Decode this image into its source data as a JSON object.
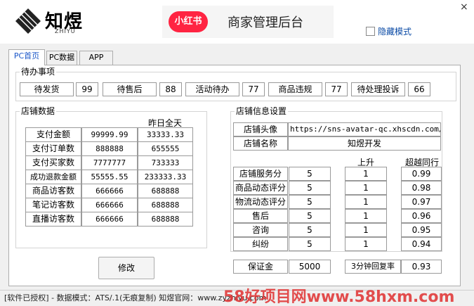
{
  "header": {
    "logo_text": "知煜",
    "logo_sub": "ZHIYU",
    "brand_badge": "小红书",
    "brand_title": "商家管理后台",
    "close_label": "×",
    "hide_mode_label": "隐藏模式"
  },
  "tabs": [
    {
      "label": "PC首页",
      "active": true
    },
    {
      "label": "PC数据",
      "active": false
    },
    {
      "label": "APP",
      "active": false
    }
  ],
  "todo": {
    "title": "待办事项",
    "items": [
      {
        "label": "待发货",
        "value": "99"
      },
      {
        "label": "待售后",
        "value": "88"
      },
      {
        "label": "活动待办",
        "value": "77"
      },
      {
        "label": "商品违规",
        "value": "77"
      },
      {
        "label": "待处理投诉",
        "value": "66"
      }
    ]
  },
  "shop_data": {
    "title": "店铺数据",
    "col_header": "昨日全天",
    "rows": [
      {
        "label": "支付金额",
        "today": "99999.99",
        "yesterday": "33333.33"
      },
      {
        "label": "支付订单数",
        "today": "888888",
        "yesterday": "655555"
      },
      {
        "label": "支付买家数",
        "today": "7777777",
        "yesterday": "733333"
      },
      {
        "label": "成功退款金额",
        "today": "55555.55",
        "yesterday": "233333.33"
      },
      {
        "label": "商品访客数",
        "today": "666666",
        "yesterday": "688888"
      },
      {
        "label": "笔记访客数",
        "today": "666666",
        "yesterday": "688888"
      },
      {
        "label": "直播访客数",
        "today": "666666",
        "yesterday": "688888"
      }
    ]
  },
  "shop_info": {
    "title": "店铺信息设置",
    "avatar_label": "店铺头像",
    "avatar_value": "https://sns-avatar-qc.xhscdn.com/ava",
    "name_label": "店铺名称",
    "name_value": "知煜开发",
    "col_up": "上升",
    "col_beat": "超越同行",
    "scores": [
      {
        "label": "店铺服务分",
        "score": "5",
        "up": "1",
        "beat": "0.99"
      },
      {
        "label": "商品动态评分",
        "score": "5",
        "up": "1",
        "beat": "0.98"
      },
      {
        "label": "物流动态评分",
        "score": "5",
        "up": "1",
        "beat": "0.97"
      },
      {
        "label": "售后",
        "score": "5",
        "up": "1",
        "beat": "0.96"
      },
      {
        "label": "咨询",
        "score": "5",
        "up": "1",
        "beat": "0.95"
      },
      {
        "label": "纠纷",
        "score": "5",
        "up": "1",
        "beat": "0.94"
      }
    ],
    "deposit_label": "保证金",
    "deposit_value": "5000",
    "reply_label": "3分钟回复率",
    "reply_value": "0.93"
  },
  "modify_button": "修改",
  "status_bar": "[软件已授权] - 数据模式：ATS/.1(无痕复制) 知煜官网：www.zyzhiyu.com",
  "watermark": "58好项目网www.58hxm.com",
  "colors": {
    "brand": "#ff2442",
    "tab_active": "#1a56c8",
    "link": "#0a4aa5"
  }
}
